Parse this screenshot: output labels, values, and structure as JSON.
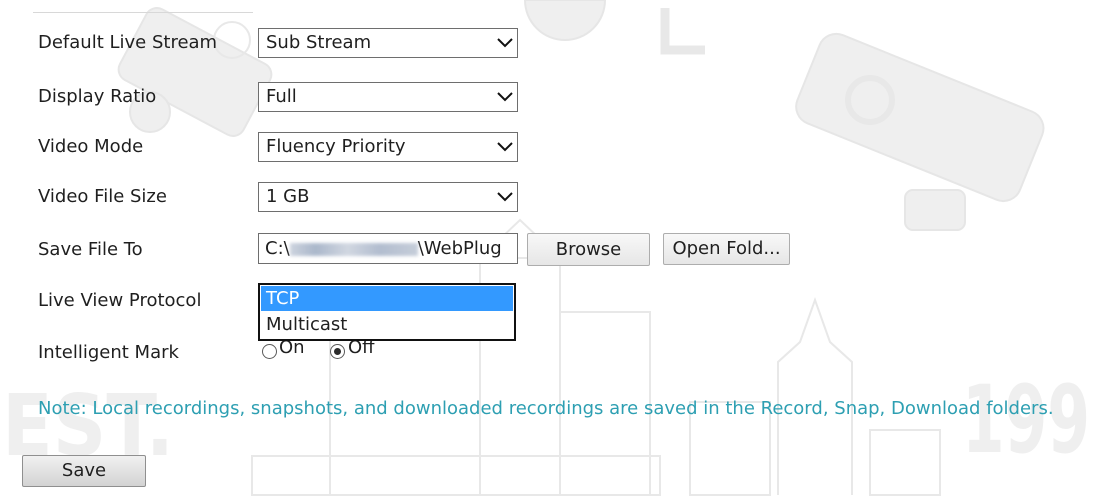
{
  "colors": {
    "label_text": "#1f1f1f",
    "note_text": "#2d9fb2",
    "selection_bg": "#3399ff",
    "selection_text": "#ffffff",
    "button_bg": "#e6e6e6",
    "field_border": "#6e6e6e",
    "watermark": "#efefef"
  },
  "icons": {
    "select_arrow": "chevron-down-icon",
    "radio": "radio-button-icon"
  },
  "settings": {
    "default_live_stream": {
      "label": "Default Live Stream",
      "value": "Sub Stream"
    },
    "display_ratio": {
      "label": "Display Ratio",
      "value": "Full"
    },
    "video_mode": {
      "label": "Video Mode",
      "value": "Fluency Priority"
    },
    "video_file_size": {
      "label": "Video File Size",
      "value": "1 GB"
    },
    "save_file_to": {
      "label": "Save File To",
      "path_start": "C:\\",
      "path_end": "\\WebPlug",
      "browse_label": "Browse",
      "open_folder_label": "Open Fold..."
    },
    "live_view_protocol": {
      "label": "Live View Protocol",
      "dropdown_open": true,
      "options": [
        "TCP",
        "Multicast"
      ],
      "highlighted_option": "TCP"
    },
    "intelligent_mark": {
      "label": "Intelligent Mark",
      "options": [
        {
          "label": "On",
          "checked": false
        },
        {
          "label": "Off",
          "checked": true
        }
      ]
    }
  },
  "note": "Note: Local recordings, snapshots, and downloaded recordings are saved in the Record, Snap, Download folders.",
  "save_label": "Save",
  "watermark": {
    "left_text": "EST.",
    "right_text": "199"
  }
}
